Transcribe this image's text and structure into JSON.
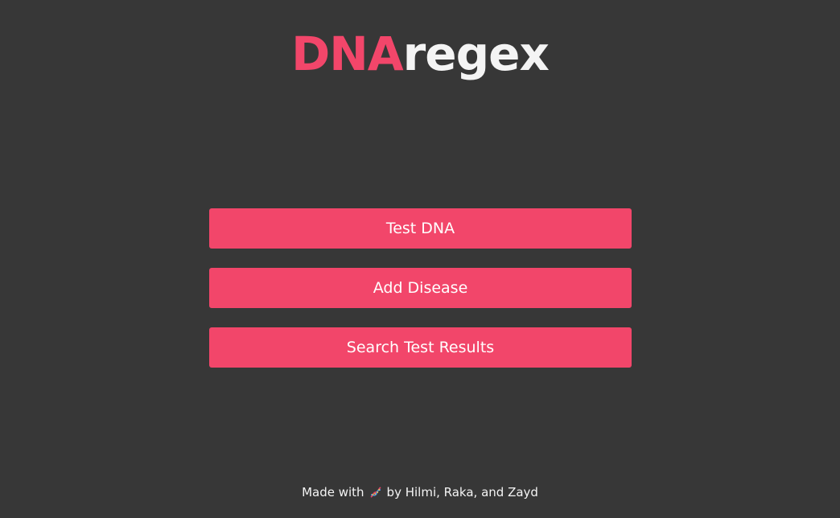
{
  "header": {
    "title_accent": "DNA",
    "title_rest": "regex"
  },
  "menu": {
    "test_dna_label": "Test DNA",
    "add_disease_label": "Add Disease",
    "search_results_label": "Search Test Results"
  },
  "footer": {
    "prefix": "Made with",
    "icon": "dna-icon",
    "suffix": "by Hilmi, Raka, and Zayd"
  },
  "colors": {
    "background": "#373737",
    "accent": "#f2466a",
    "text": "#f4f4f4"
  }
}
